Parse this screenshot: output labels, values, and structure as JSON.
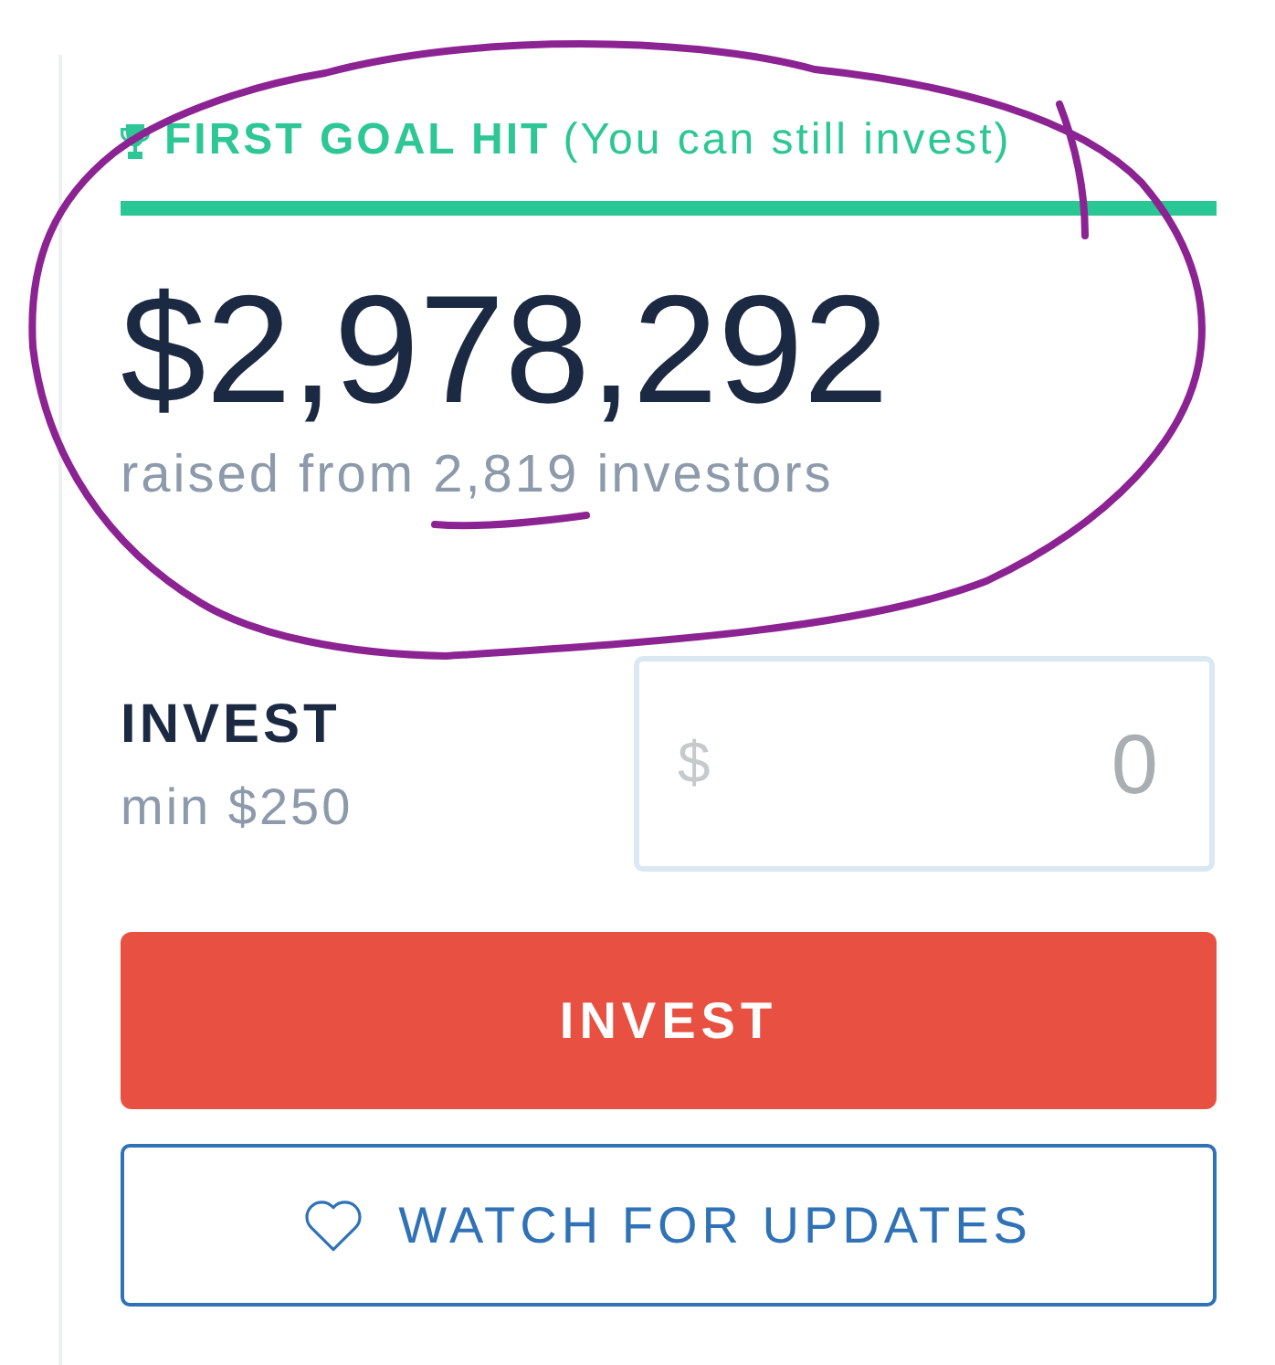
{
  "goal_banner": {
    "title": "FIRST GOAL HIT",
    "note": "(You can still invest)"
  },
  "progress": {
    "level": 1
  },
  "amount_raised": "$2,978,292",
  "investors_line": "raised from 2,819 investors",
  "invest_field": {
    "label": "INVEST",
    "minimum": "min $250",
    "currency": "$",
    "placeholder": "0"
  },
  "buttons": [
    {
      "kind": "primary",
      "label": "INVEST"
    },
    {
      "kind": "secondary",
      "label": "WATCH FOR UPDATES"
    }
  ],
  "annotations": {
    "circled_total": true,
    "underlined_count": true
  }
}
